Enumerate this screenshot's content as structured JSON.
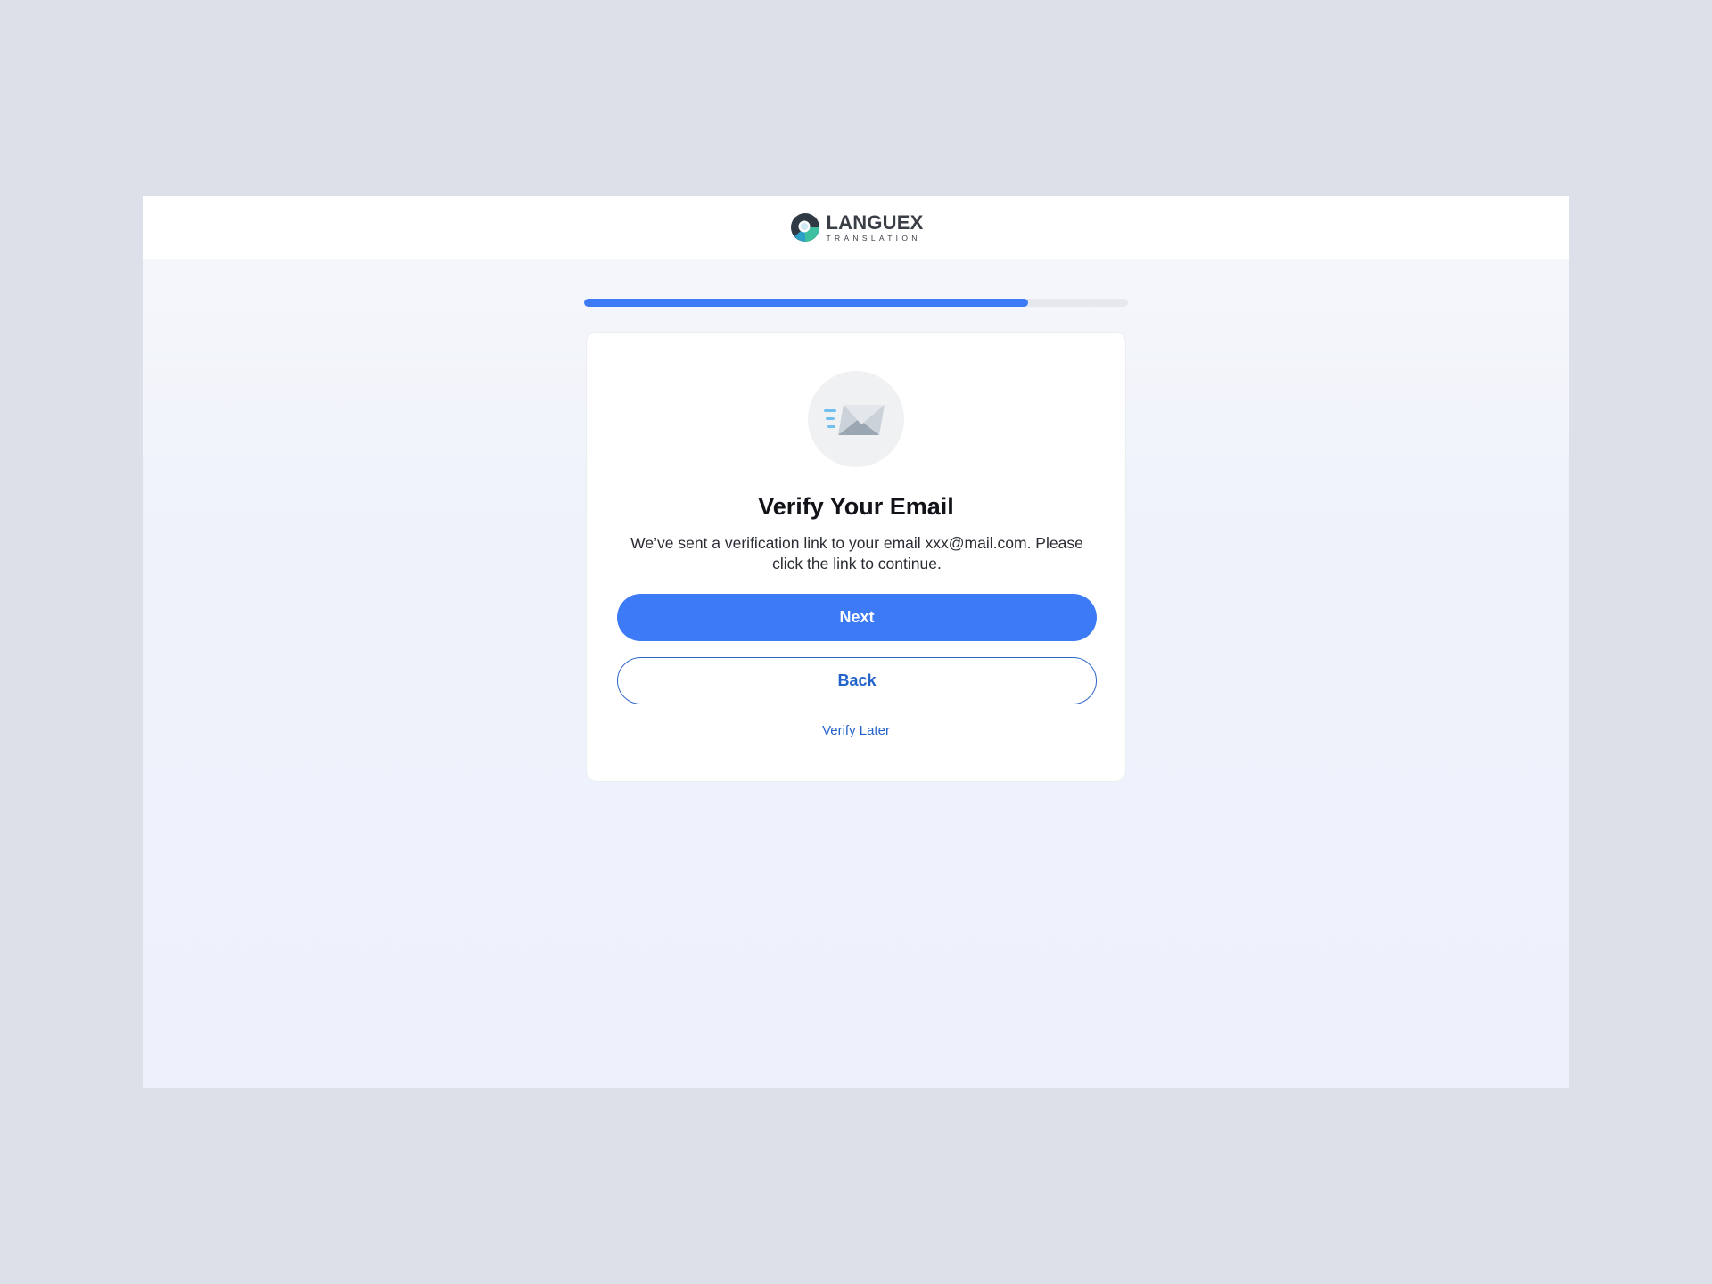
{
  "brand": {
    "name": "LANGUEX",
    "tagline": "TRANSLATION",
    "logo_icon": "languex-logo-icon"
  },
  "progress": {
    "fraction": 0.816
  },
  "verify": {
    "icon": "envelope-sending-icon",
    "title": "Verify Your Email",
    "description": "We’ve sent a verification link to your email xxx@mail.com. Please click the link to continue.",
    "next_label": "Next",
    "back_label": "Back",
    "later_label": "Verify Later"
  },
  "colors": {
    "accent": "#3d7bf6",
    "link": "#2463c9",
    "page_bg": "#dce0e8"
  }
}
